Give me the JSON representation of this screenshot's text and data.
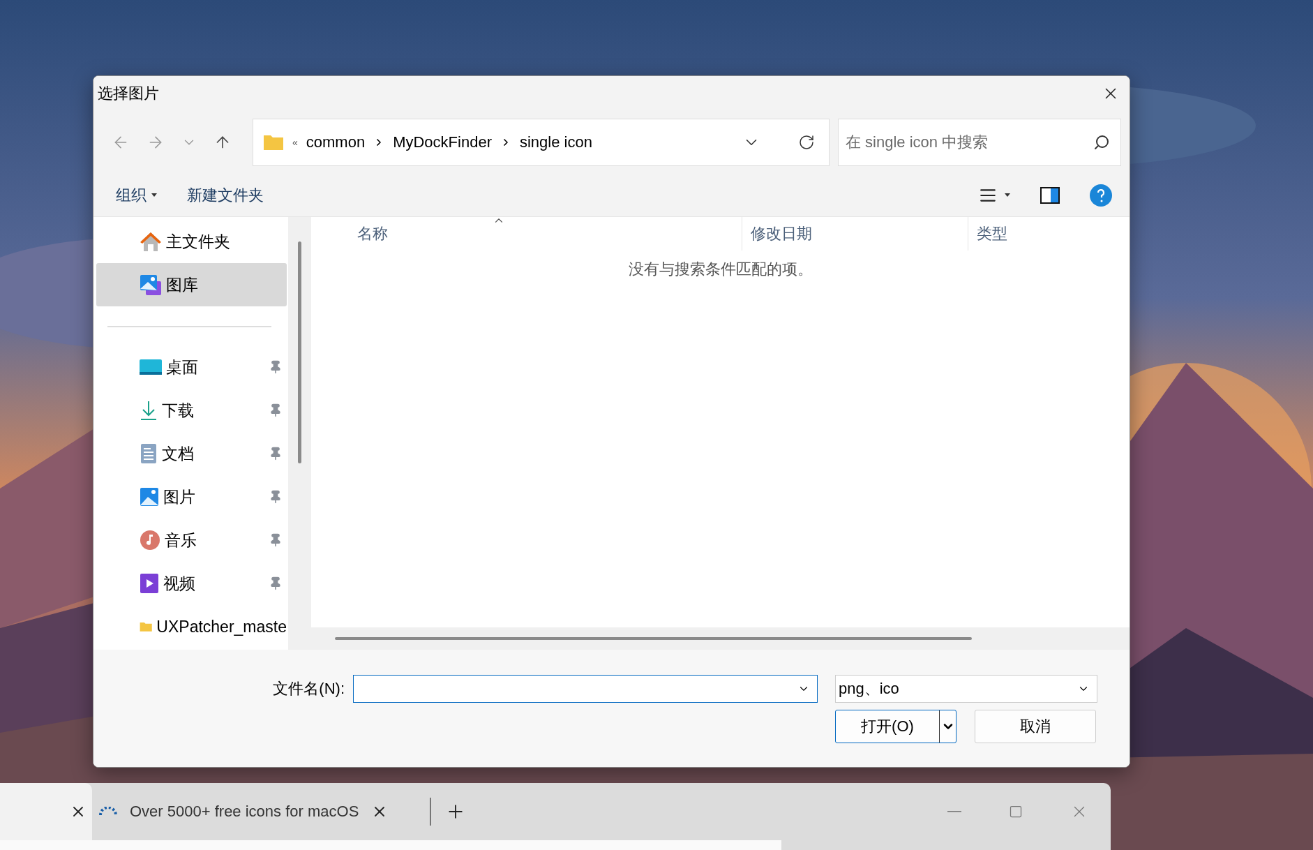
{
  "dialog": {
    "title": "选择图片",
    "nav": {
      "overflow": "«",
      "path": [
        "common",
        "MyDockFinder",
        "single icon"
      ],
      "search": {
        "placeholder": "在 single icon 中搜索"
      }
    },
    "toolbar": {
      "organize": "组织",
      "new_folder": "新建文件夹"
    },
    "sidebar": {
      "items": [
        {
          "label": "主文件夹",
          "selected": false,
          "pinned": false
        },
        {
          "label": "图库",
          "selected": true,
          "pinned": false
        },
        {
          "label": "桌面",
          "selected": false,
          "pinned": true
        },
        {
          "label": "下载",
          "selected": false,
          "pinned": true
        },
        {
          "label": "文档",
          "selected": false,
          "pinned": true
        },
        {
          "label": "图片",
          "selected": false,
          "pinned": true
        },
        {
          "label": "音乐",
          "selected": false,
          "pinned": true
        },
        {
          "label": "视频",
          "selected": false,
          "pinned": true
        },
        {
          "label": "UXPatcher_maste",
          "selected": false,
          "pinned": false
        }
      ]
    },
    "columns": [
      {
        "label": "名称",
        "sorted": true
      },
      {
        "label": "修改日期",
        "sorted": false
      },
      {
        "label": "类型",
        "sorted": false
      }
    ],
    "empty_message": "没有与搜索条件匹配的项。",
    "filename": {
      "label": "文件名(N):"
    },
    "filetype": "png、ico",
    "buttons": [
      {
        "label": "打开(O)",
        "kind": "split"
      },
      {
        "label": "取消",
        "kind": "plain"
      }
    ]
  },
  "browser": {
    "tabs": [
      {
        "selected": true
      },
      {
        "title": "Over 5000+ free icons for macOS",
        "selected": false
      }
    ]
  }
}
